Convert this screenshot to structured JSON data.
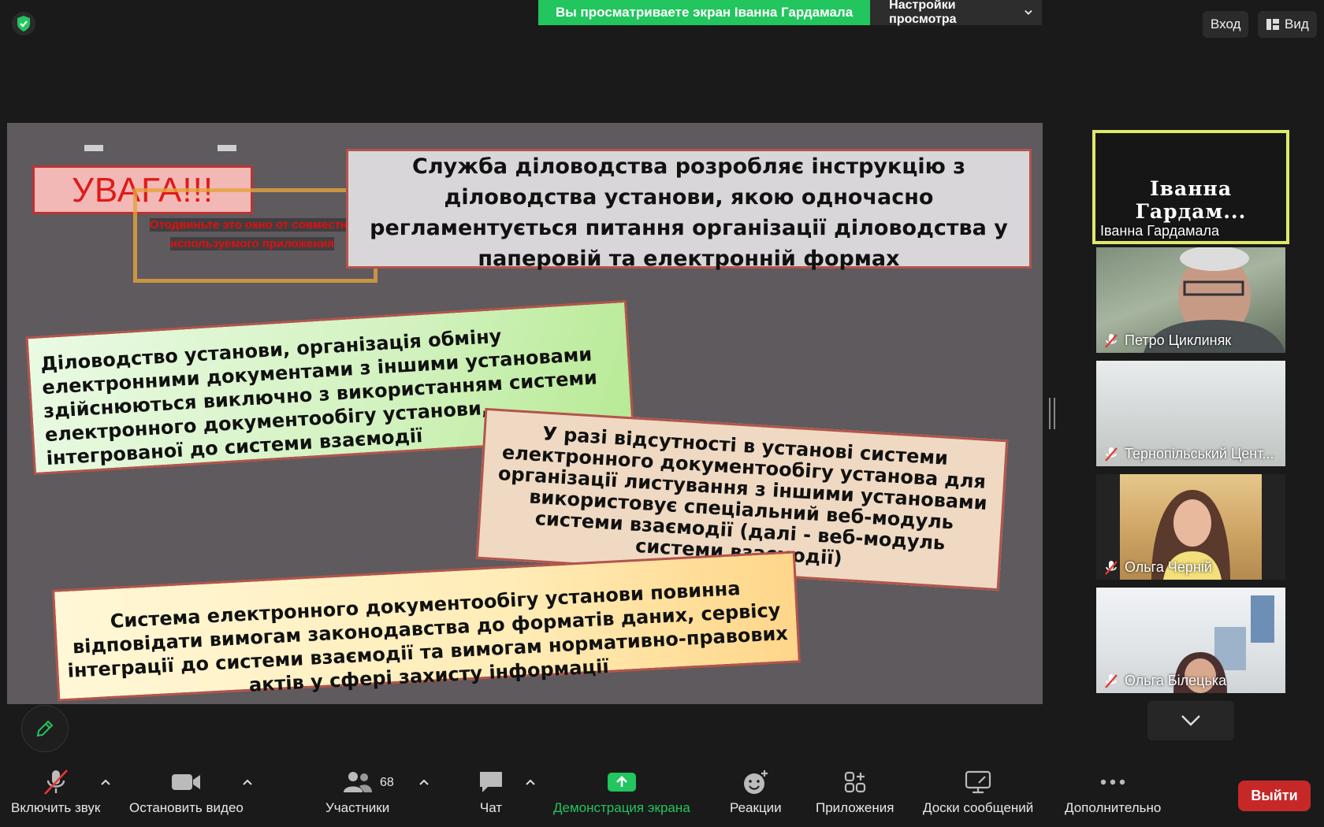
{
  "top": {
    "banner_text": "Вы просматриваете экран Іванна Гардамала",
    "view_options": "Настройки просмотра",
    "login": "Вход",
    "view": "Вид"
  },
  "slide": {
    "attention": "УВАГА!!!",
    "overlay_line1": "Отодвиньте это окно от совместно",
    "overlay_line2": "используемого приложения",
    "box1": "Служба діловодства розробляє інструкцію з діловодства установи, якою одночасно регламентується питання організації діловодства у паперовій та електронній формах",
    "box2": "Діловодство установи, організація обміну електронними документами з іншими установами здійснюються виключно з використанням системи електронного документообігу установи, інтегрованої до системи взаємодії",
    "box3": "У разі відсутності в установі системи електронного документообігу установа для організації листування з іншими установами використовує спеціальний веб-модуль системи взаємодії (далі - веб-модуль системи взаємодії)",
    "box4": "Система електронного документообігу установи повинна відповідати вимогам законодавства до форматів даних, сервісу інтеграції до системи взаємодії та вимогам нормативно-правових актів у сфері захисту інформації"
  },
  "participants": [
    {
      "big_label": "Іванна Гардам...",
      "name": "Іванна Гардамала"
    },
    {
      "name": "Петро Циклиняк"
    },
    {
      "name": "Тернопільський Цент..."
    },
    {
      "name": "Ольга Черній"
    },
    {
      "name": "Ольга Білецька"
    }
  ],
  "toolbar": {
    "mute": "Включить звук",
    "video": "Остановить видео",
    "participants": "Участники",
    "participants_count": "68",
    "chat": "Чат",
    "share": "Демонстрация экрана",
    "reactions": "Реакции",
    "apps": "Приложения",
    "whiteboards": "Доски сообщений",
    "more": "Дополнительно",
    "leave": "Выйти"
  },
  "colors": {
    "accent_green": "#22c55e",
    "active_speaker_border": "#dfe86a",
    "leave_red": "#c62828"
  }
}
